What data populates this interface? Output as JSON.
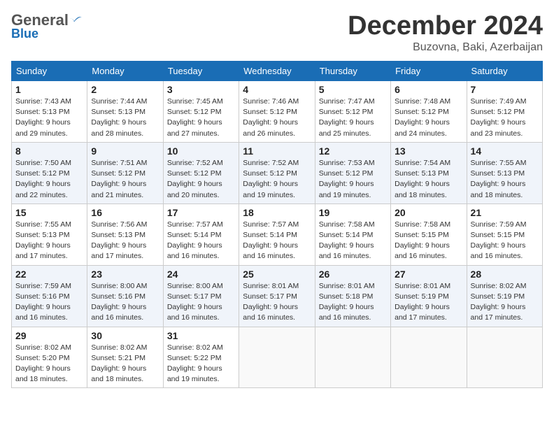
{
  "header": {
    "logo_general": "General",
    "logo_blue": "Blue",
    "month_title": "December 2024",
    "location": "Buzovna, Baki, Azerbaijan"
  },
  "weekdays": [
    "Sunday",
    "Monday",
    "Tuesday",
    "Wednesday",
    "Thursday",
    "Friday",
    "Saturday"
  ],
  "weeks": [
    [
      {
        "day": "1",
        "info": "Sunrise: 7:43 AM\nSunset: 5:13 PM\nDaylight: 9 hours\nand 29 minutes."
      },
      {
        "day": "2",
        "info": "Sunrise: 7:44 AM\nSunset: 5:13 PM\nDaylight: 9 hours\nand 28 minutes."
      },
      {
        "day": "3",
        "info": "Sunrise: 7:45 AM\nSunset: 5:12 PM\nDaylight: 9 hours\nand 27 minutes."
      },
      {
        "day": "4",
        "info": "Sunrise: 7:46 AM\nSunset: 5:12 PM\nDaylight: 9 hours\nand 26 minutes."
      },
      {
        "day": "5",
        "info": "Sunrise: 7:47 AM\nSunset: 5:12 PM\nDaylight: 9 hours\nand 25 minutes."
      },
      {
        "day": "6",
        "info": "Sunrise: 7:48 AM\nSunset: 5:12 PM\nDaylight: 9 hours\nand 24 minutes."
      },
      {
        "day": "7",
        "info": "Sunrise: 7:49 AM\nSunset: 5:12 PM\nDaylight: 9 hours\nand 23 minutes."
      }
    ],
    [
      {
        "day": "8",
        "info": "Sunrise: 7:50 AM\nSunset: 5:12 PM\nDaylight: 9 hours\nand 22 minutes."
      },
      {
        "day": "9",
        "info": "Sunrise: 7:51 AM\nSunset: 5:12 PM\nDaylight: 9 hours\nand 21 minutes."
      },
      {
        "day": "10",
        "info": "Sunrise: 7:52 AM\nSunset: 5:12 PM\nDaylight: 9 hours\nand 20 minutes."
      },
      {
        "day": "11",
        "info": "Sunrise: 7:52 AM\nSunset: 5:12 PM\nDaylight: 9 hours\nand 19 minutes."
      },
      {
        "day": "12",
        "info": "Sunrise: 7:53 AM\nSunset: 5:12 PM\nDaylight: 9 hours\nand 19 minutes."
      },
      {
        "day": "13",
        "info": "Sunrise: 7:54 AM\nSunset: 5:13 PM\nDaylight: 9 hours\nand 18 minutes."
      },
      {
        "day": "14",
        "info": "Sunrise: 7:55 AM\nSunset: 5:13 PM\nDaylight: 9 hours\nand 18 minutes."
      }
    ],
    [
      {
        "day": "15",
        "info": "Sunrise: 7:55 AM\nSunset: 5:13 PM\nDaylight: 9 hours\nand 17 minutes."
      },
      {
        "day": "16",
        "info": "Sunrise: 7:56 AM\nSunset: 5:13 PM\nDaylight: 9 hours\nand 17 minutes."
      },
      {
        "day": "17",
        "info": "Sunrise: 7:57 AM\nSunset: 5:14 PM\nDaylight: 9 hours\nand 16 minutes."
      },
      {
        "day": "18",
        "info": "Sunrise: 7:57 AM\nSunset: 5:14 PM\nDaylight: 9 hours\nand 16 minutes."
      },
      {
        "day": "19",
        "info": "Sunrise: 7:58 AM\nSunset: 5:14 PM\nDaylight: 9 hours\nand 16 minutes."
      },
      {
        "day": "20",
        "info": "Sunrise: 7:58 AM\nSunset: 5:15 PM\nDaylight: 9 hours\nand 16 minutes."
      },
      {
        "day": "21",
        "info": "Sunrise: 7:59 AM\nSunset: 5:15 PM\nDaylight: 9 hours\nand 16 minutes."
      }
    ],
    [
      {
        "day": "22",
        "info": "Sunrise: 7:59 AM\nSunset: 5:16 PM\nDaylight: 9 hours\nand 16 minutes."
      },
      {
        "day": "23",
        "info": "Sunrise: 8:00 AM\nSunset: 5:16 PM\nDaylight: 9 hours\nand 16 minutes."
      },
      {
        "day": "24",
        "info": "Sunrise: 8:00 AM\nSunset: 5:17 PM\nDaylight: 9 hours\nand 16 minutes."
      },
      {
        "day": "25",
        "info": "Sunrise: 8:01 AM\nSunset: 5:17 PM\nDaylight: 9 hours\nand 16 minutes."
      },
      {
        "day": "26",
        "info": "Sunrise: 8:01 AM\nSunset: 5:18 PM\nDaylight: 9 hours\nand 16 minutes."
      },
      {
        "day": "27",
        "info": "Sunrise: 8:01 AM\nSunset: 5:19 PM\nDaylight: 9 hours\nand 17 minutes."
      },
      {
        "day": "28",
        "info": "Sunrise: 8:02 AM\nSunset: 5:19 PM\nDaylight: 9 hours\nand 17 minutes."
      }
    ],
    [
      {
        "day": "29",
        "info": "Sunrise: 8:02 AM\nSunset: 5:20 PM\nDaylight: 9 hours\nand 18 minutes."
      },
      {
        "day": "30",
        "info": "Sunrise: 8:02 AM\nSunset: 5:21 PM\nDaylight: 9 hours\nand 18 minutes."
      },
      {
        "day": "31",
        "info": "Sunrise: 8:02 AM\nSunset: 5:22 PM\nDaylight: 9 hours\nand 19 minutes."
      },
      null,
      null,
      null,
      null
    ]
  ]
}
